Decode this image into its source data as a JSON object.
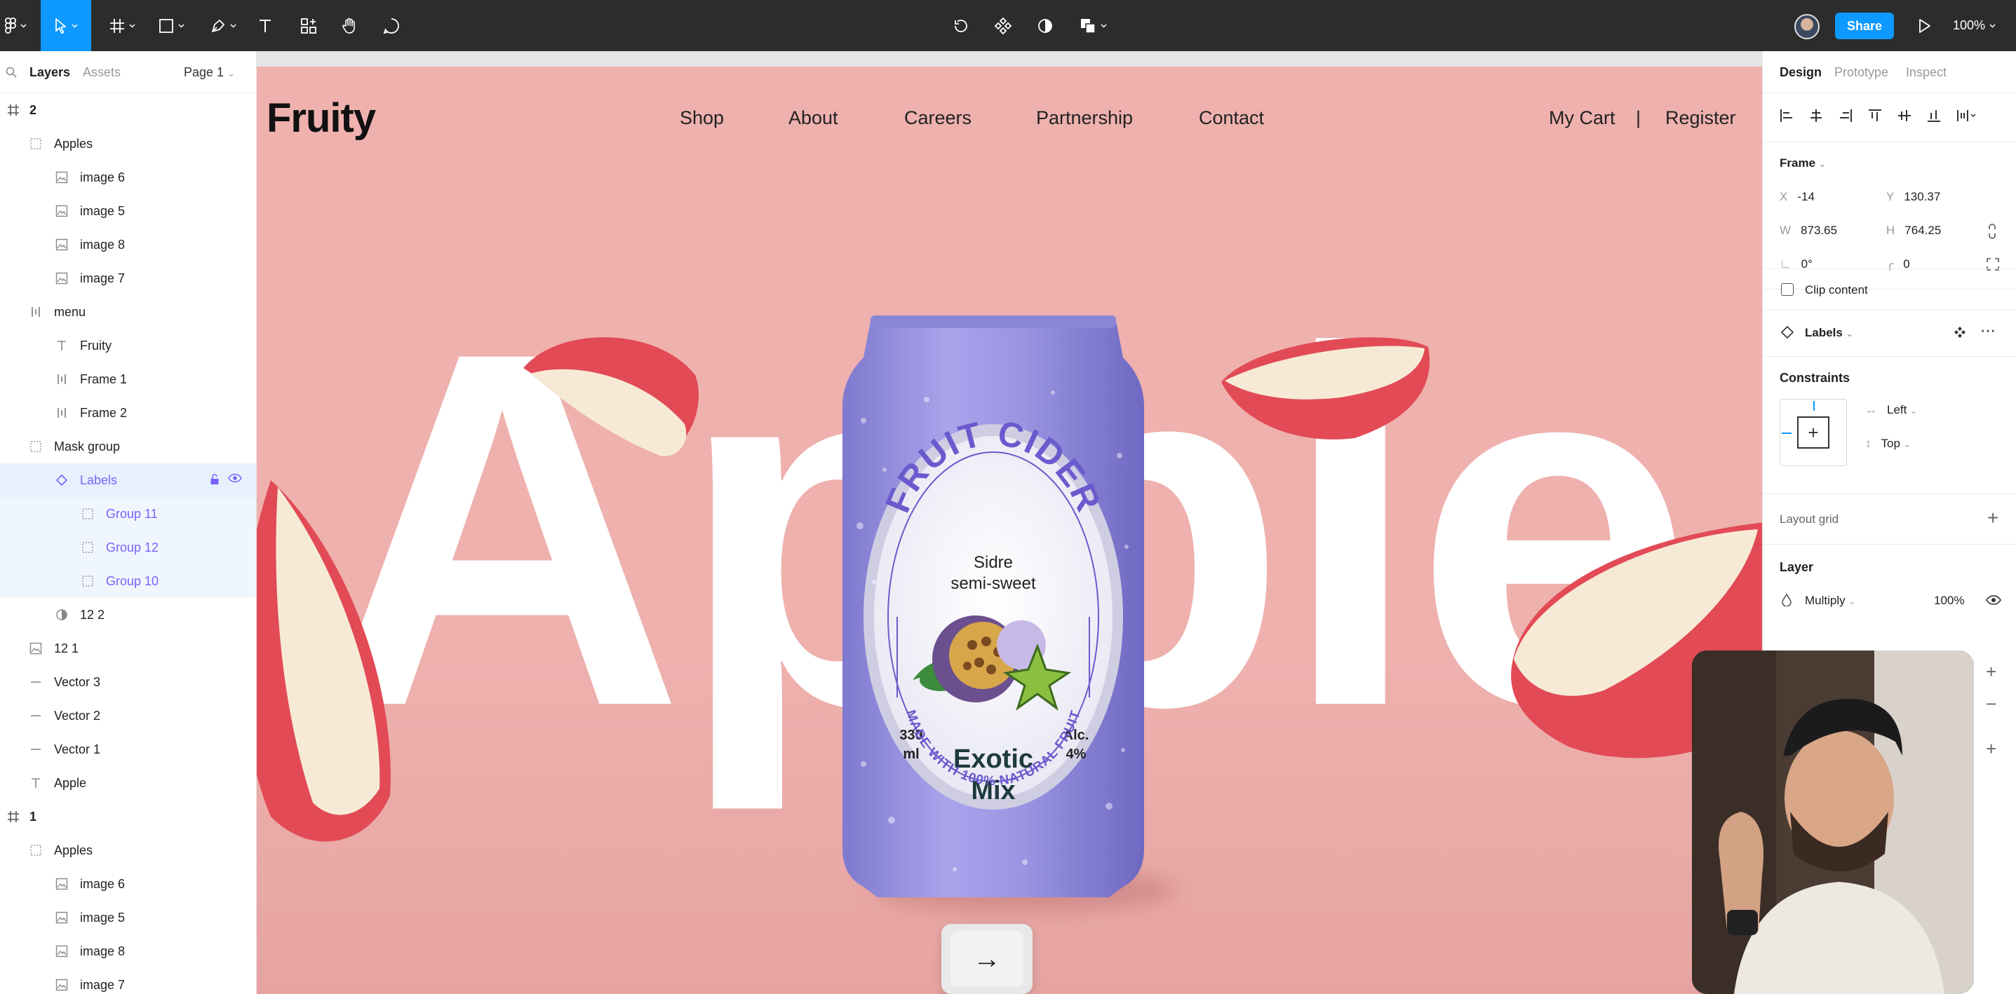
{
  "toolbar": {
    "share_label": "Share",
    "zoom": "100%",
    "icons": [
      "figma-menu-icon",
      "move-tool-icon",
      "frame-tool-icon",
      "shape-tool-icon",
      "pen-tool-icon",
      "text-tool-icon",
      "components-icon",
      "hand-tool-icon",
      "comment-icon",
      "vector-edit-icon",
      "component-icon",
      "contrast-icon",
      "boolean-icon",
      "play-icon"
    ]
  },
  "left_panel": {
    "tabs": [
      "Layers",
      "Assets"
    ],
    "page": "Page 1",
    "layers": [
      {
        "label": "2",
        "type": "frame",
        "icon": "frame-icon"
      },
      {
        "label": "Apples",
        "type": "group",
        "icon": "group-icon"
      },
      {
        "label": "image 6",
        "type": "image",
        "icon": "image-icon"
      },
      {
        "label": "image 5",
        "type": "image",
        "icon": "image-icon"
      },
      {
        "label": "image 8",
        "type": "image",
        "icon": "image-icon"
      },
      {
        "label": "image 7",
        "type": "image",
        "icon": "image-icon"
      },
      {
        "label": "menu",
        "type": "autolayout",
        "icon": "autolayout-icon"
      },
      {
        "label": "Fruity",
        "type": "text",
        "icon": "text-icon"
      },
      {
        "label": "Frame 1",
        "type": "autolayout",
        "icon": "autolayout-icon"
      },
      {
        "label": "Frame 2",
        "type": "autolayout",
        "icon": "autolayout-icon"
      },
      {
        "label": "Mask group",
        "type": "group",
        "icon": "group-icon"
      },
      {
        "label": "Labels",
        "type": "component",
        "icon": "component-icon"
      },
      {
        "label": "Group 11",
        "type": "group",
        "icon": "group-icon"
      },
      {
        "label": "Group 12",
        "type": "group",
        "icon": "group-icon"
      },
      {
        "label": "Group 10",
        "type": "group",
        "icon": "group-icon"
      },
      {
        "label": "12 2",
        "type": "mask",
        "icon": "mask-icon"
      },
      {
        "label": "12 1",
        "type": "image",
        "icon": "image-icon"
      },
      {
        "label": "Vector 3",
        "type": "vector",
        "icon": "line-icon"
      },
      {
        "label": "Vector 2",
        "type": "vector",
        "icon": "line-icon"
      },
      {
        "label": "Vector 1",
        "type": "vector",
        "icon": "line-icon"
      },
      {
        "label": "Apple",
        "type": "text",
        "icon": "text-icon"
      },
      {
        "label": "1",
        "type": "frame",
        "icon": "frame-icon"
      },
      {
        "label": "Apples",
        "type": "group",
        "icon": "group-icon"
      },
      {
        "label": "image 6",
        "type": "image",
        "icon": "image-icon"
      },
      {
        "label": "image 5",
        "type": "image",
        "icon": "image-icon"
      },
      {
        "label": "image 8",
        "type": "image",
        "icon": "image-icon"
      },
      {
        "label": "image 7",
        "type": "image",
        "icon": "image-icon"
      }
    ]
  },
  "canvas": {
    "logo": "Fruity",
    "nav": [
      "Shop",
      "About",
      "Careers",
      "Partnership",
      "Contact"
    ],
    "cart": "My Cart",
    "separator": "|",
    "register": "Register",
    "hero_word": "Apple",
    "can": {
      "arc_title": "FRUIT CIDER",
      "subtitle_1": "Sidre",
      "subtitle_2": "semi-sweet",
      "volume_1": "330",
      "volume_2": "ml",
      "alc_1": "Alc.",
      "alc_2": "4%",
      "name_1": "Exotic",
      "name_2": "Mix",
      "arc_bottom": "MADE WITH 100% NATURAL FRUIT"
    },
    "next_arrow": "→",
    "colors": {
      "background": "#eeb1ae",
      "can": "#9d97e3",
      "accent": "#6a5acd"
    }
  },
  "right_panel": {
    "tabs": [
      "Design",
      "Prototype",
      "Inspect"
    ],
    "frame_title": "Frame",
    "x_label": "X",
    "x": "-14",
    "y_label": "Y",
    "y": "130.37",
    "w_label": "W",
    "w": "873.65",
    "h_label": "H",
    "h": "764.25",
    "rotation": "0°",
    "radius": "0",
    "clip_content": "Clip content",
    "component": "Labels",
    "constraints_title": "Constraints",
    "constraint_h": "Left",
    "constraint_v": "Top",
    "layout_grid": "Layout grid",
    "layer_title": "Layer",
    "blend_mode": "Multiply",
    "opacity": "100%"
  }
}
